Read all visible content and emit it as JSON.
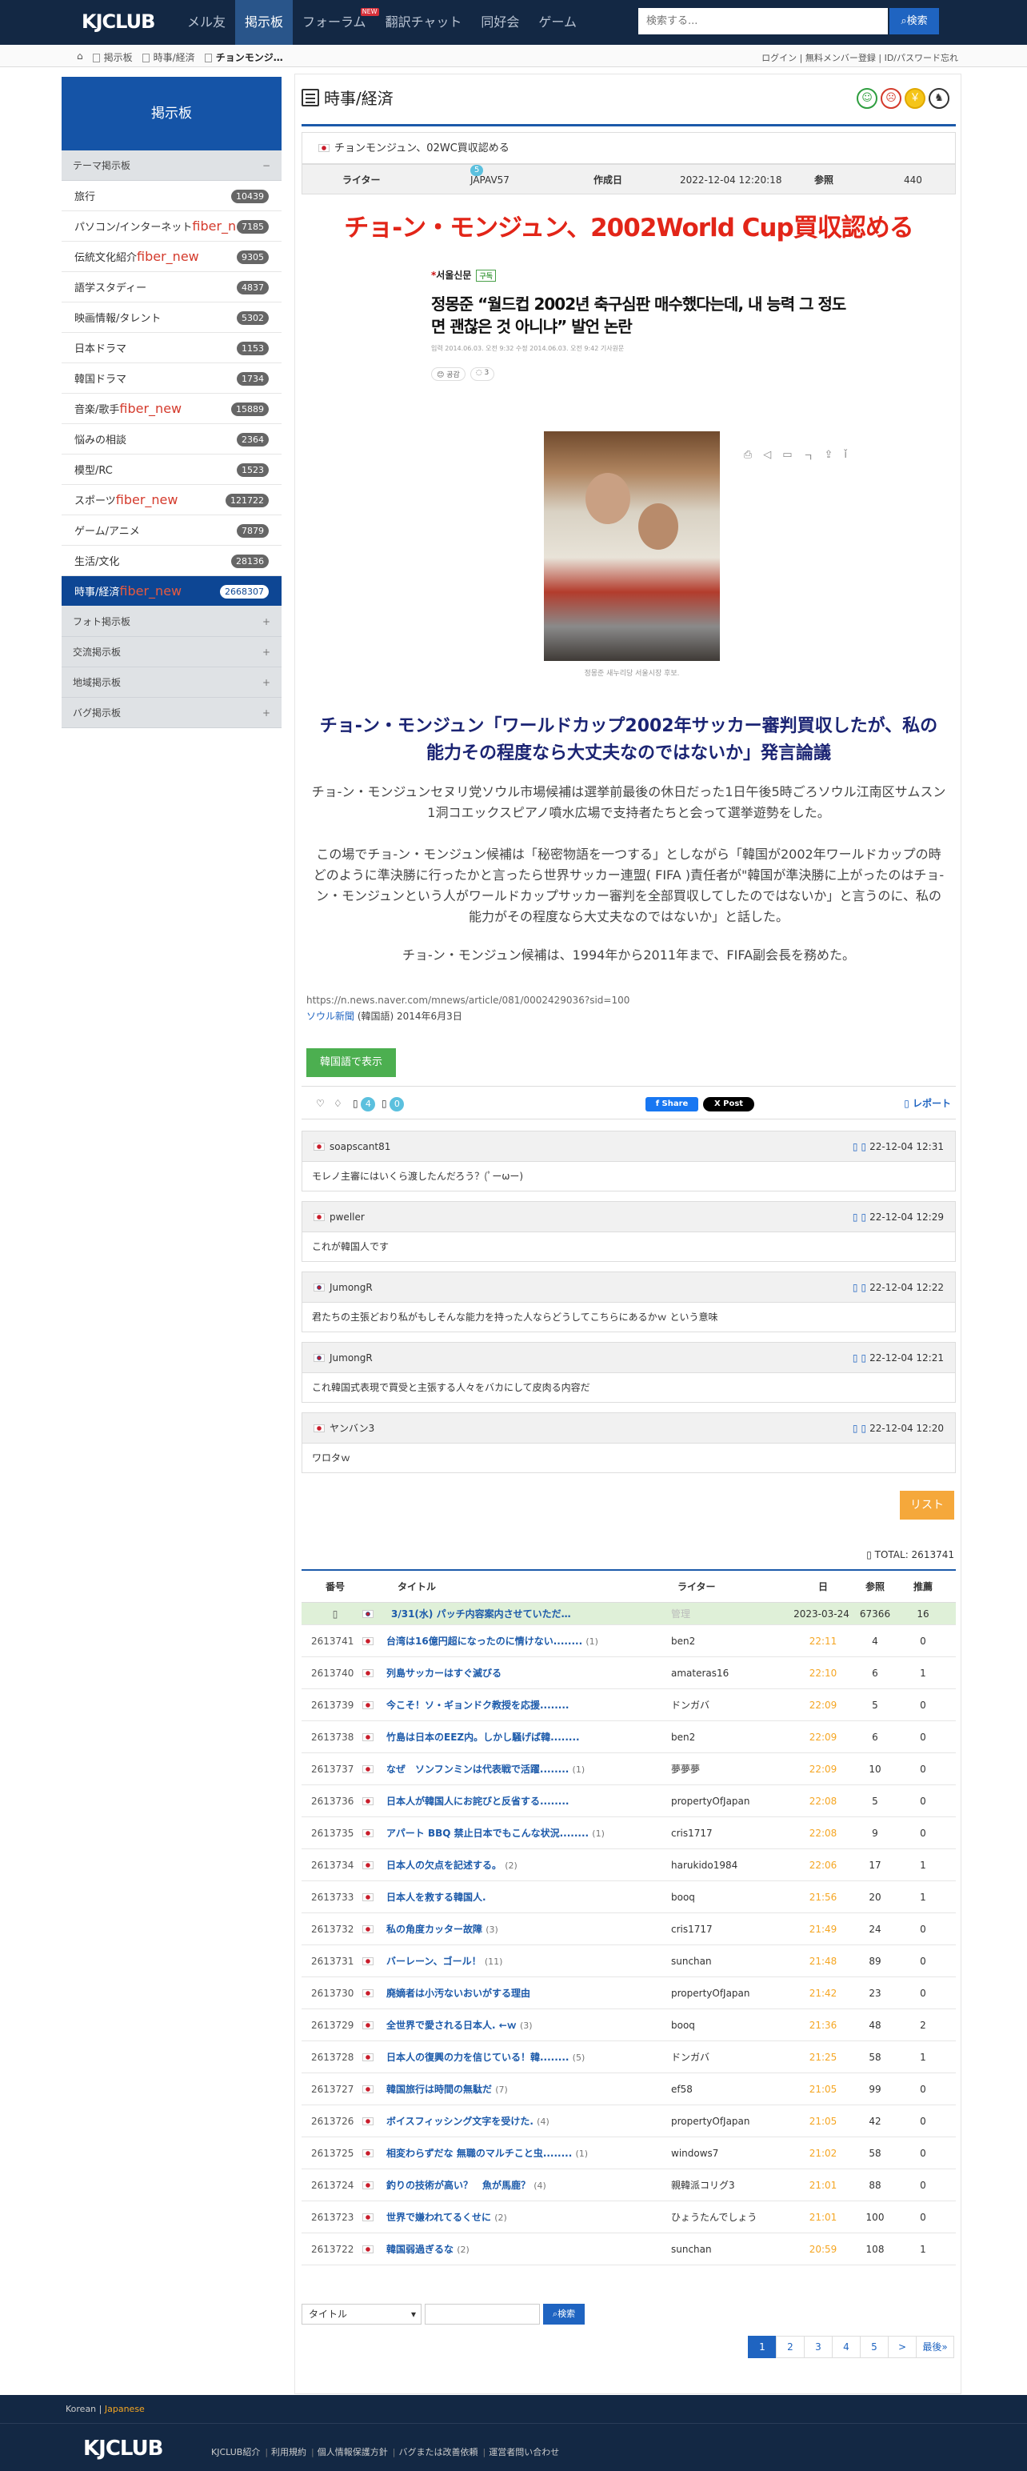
{
  "header": {
    "logo": "KJCLUB",
    "nav": [
      "メル友",
      "掲示板",
      "フォーラム",
      "翻訳チャット",
      "同好会",
      "ゲーム"
    ],
    "nav_new": "NEW",
    "search_placeholder": "検索する...",
    "search_button": "検索"
  },
  "breadcrumb": {
    "items": [
      "掲示板",
      "時事/経済",
      "チョンモンジ…"
    ]
  },
  "userlinks": "ログイン | 無料メンバー登録 | ID/パスワード忘れ",
  "sidebar": {
    "title": "掲示板",
    "section": "テーマ掲示板",
    "items": [
      {
        "label": "旅行",
        "new": "",
        "count": "10439"
      },
      {
        "label": "パソコン/インターネット",
        "new": "fiber_new",
        "count": "7185"
      },
      {
        "label": "伝統文化紹介",
        "new": "fiber_new",
        "count": "9305"
      },
      {
        "label": "語学スタディー",
        "new": "",
        "count": "4837"
      },
      {
        "label": "映画情報/タレント",
        "new": "",
        "count": "5302"
      },
      {
        "label": "日本ドラマ",
        "new": "",
        "count": "1153"
      },
      {
        "label": "韓国ドラマ",
        "new": "",
        "count": "1734"
      },
      {
        "label": "音楽/歌手",
        "new": "fiber_new",
        "count": "15889"
      },
      {
        "label": "悩みの相談",
        "new": "",
        "count": "2364"
      },
      {
        "label": "模型/RC",
        "new": "",
        "count": "1523"
      },
      {
        "label": "スポーツ",
        "new": "fiber_new",
        "count": "121722"
      },
      {
        "label": "ゲーム/アニメ",
        "new": "",
        "count": "7879"
      },
      {
        "label": "生活/文化",
        "new": "",
        "count": "28136"
      },
      {
        "label": "時事/経済",
        "new": "fiber_new",
        "count": "2668307"
      }
    ],
    "sections": [
      "フォト掲示板",
      "交流掲示板",
      "地域掲示板",
      "バグ掲示板"
    ]
  },
  "board": {
    "title": "時事/経済",
    "icons": [
      "☺",
      "☹",
      "￥",
      "♞"
    ]
  },
  "post": {
    "subject": "チョンモンジュン、02WC買収認める",
    "meta": {
      "writer_label": "ライター",
      "level": "5",
      "writer": "JAPAV57",
      "date_label": "作成日",
      "date": "2022-12-04 12:20:18",
      "views_label": "参照",
      "views": "440"
    },
    "headline": "チョ-ン・モンジュン、2002World Cup買収認める",
    "embed": {
      "paper": "서울신문",
      "subscribe": "구독",
      "title1": "정몽준 “월드컵 2002년 축구심판 매수했다는데, 내 능력 그 정도",
      "title2": "면 괜찮은 것 아니냐” 발언 논란",
      "meta": "입력 2014.06.03. 오전 9:32   수정 2014.06.03. 오전 9:42   기사원문",
      "react1": "공감",
      "react2": "3",
      "caption": "정몽준 새누리당 서울시장 후보."
    },
    "article_headline": "チョ-ン・モンジュン「ワールドカップ2002年サッカー審判買収したが、私の能力その程度なら大丈夫なのではないか」発言論議",
    "p1": "チョ-ン・モンジュンセヌリ党ソウル市場候補は選挙前最後の休日だった1日午後5時ごろソウル江南区サムスン1洞コエックスピアノ噴水広場で支持者たちと会って選挙遊勢をした。",
    "p2": "この場でチョ-ン・モンジュン候補は「秘密物語を一つする」としながら「韓国が2002年ワールドカップの時どのように準決勝に行ったかと言ったら世界サッカー連盟( FIFA )責任者が\"韓国が準決勝に上がったのはチョ-ン・モンジュンという人がワールドカップサッカー審判を全部買収してしたのではないか」と言うのに、私の能力がその程度なら大丈夫なのではないか」と話した。",
    "p3": "チョ-ン・モンジュン候補は、1994年から2011年まで、FIFA副会長を務めた。",
    "source_url": "https://n.news.naver.com/mnews/article/081/0002429036?sid=100",
    "source_name": "ソウル新聞",
    "source_rest": " (韓国語) 2014年6月3日",
    "kr_button": "韓国語で表示",
    "likes": "4",
    "dislikes": "0",
    "fb": "f Share",
    "x": "X Post",
    "report": "レポート"
  },
  "comments": [
    {
      "flag": "jp",
      "user": "soapscant81",
      "date": "22-12-04 12:31",
      "text": "モレノ主審にはいくら渡したんだろう？(ﾟーωー)"
    },
    {
      "flag": "jp",
      "user": "pweller",
      "date": "22-12-04 12:29",
      "text": "これが韓国人です"
    },
    {
      "flag": "kr",
      "user": "JumongR",
      "date": "22-12-04 12:22",
      "text": "君たちの主張どおり私がもしそんな能力を持った人ならどうしてこちらにあるかｗ という意味"
    },
    {
      "flag": "kr",
      "user": "JumongR",
      "date": "22-12-04 12:21",
      "text": "これ韓国式表現で買受と主張する人々をバカにして皮肉る内容だ"
    },
    {
      "flag": "jp",
      "user": "ヤンバン3",
      "date": "22-12-04 12:20",
      "text": "ワロタｗ"
    }
  ],
  "list_button": "リスト",
  "total": "TOTAL: 2613741",
  "table": {
    "headers": [
      "番号",
      "タイトル",
      "ライター",
      "日",
      "参照",
      "推薦"
    ],
    "notice": {
      "title": "3/31(水) パッチ内容案内させていただ…",
      "writer": "管理",
      "date": "2023-03-24",
      "views": "67366",
      "rec": "16"
    },
    "rows": [
      {
        "no": "2613741",
        "flag": "jp",
        "title": "台湾は16億円超になったのに情けない........",
        "cm": "(1)",
        "writer": "ben2",
        "time": "22:11",
        "views": "4",
        "rec": "0"
      },
      {
        "no": "2613740",
        "flag": "jp",
        "title": "列島サッカーはすぐ滅びる",
        "cm": "",
        "writer": "amateras16",
        "time": "22:10",
        "views": "6",
        "rec": "1"
      },
      {
        "no": "2613739",
        "flag": "jp",
        "title": "今こそ！ソ・ギョンドク教授を応援........",
        "cm": "",
        "writer": "ドンガバ",
        "time": "22:09",
        "views": "5",
        "rec": "0"
      },
      {
        "no": "2613738",
        "flag": "jp",
        "title": "竹島は日本のEEZ内。しかし騒げば韓........",
        "cm": "",
        "writer": "ben2",
        "time": "22:09",
        "views": "6",
        "rec": "0"
      },
      {
        "no": "2613737",
        "flag": "jp",
        "title": "なぜ　ソンフンミンは代表戦で活躍........",
        "cm": "(1)",
        "writer": "夢夢夢",
        "time": "22:09",
        "views": "10",
        "rec": "0"
      },
      {
        "no": "2613736",
        "flag": "jp",
        "title": "日本人が韓国人にお詫びと反省する........",
        "cm": "",
        "writer": "propertyOfJapan",
        "time": "22:08",
        "views": "5",
        "rec": "0"
      },
      {
        "no": "2613735",
        "flag": "jp",
        "title": "アパート BBQ 禁止日本でもこんな状況........",
        "cm": "(1)",
        "writer": "cris1717",
        "time": "22:08",
        "views": "9",
        "rec": "0"
      },
      {
        "no": "2613734",
        "flag": "jp",
        "title": "日本人の欠点を記述する。",
        "cm": "(2)",
        "writer": "harukido1984",
        "time": "22:06",
        "views": "17",
        "rec": "1"
      },
      {
        "no": "2613733",
        "flag": "jp",
        "title": "日本人を救する韓国人.",
        "cm": "",
        "writer": "booq",
        "time": "21:56",
        "views": "20",
        "rec": "1"
      },
      {
        "no": "2613732",
        "flag": "jp",
        "title": "私の角度カッター故障",
        "cm": "(3)",
        "writer": "cris1717",
        "time": "21:49",
        "views": "24",
        "rec": "0"
      },
      {
        "no": "2613731",
        "flag": "jp",
        "title": "バーレーン、ゴール！",
        "cm": "(11)",
        "writer": "sunchan",
        "time": "21:48",
        "views": "89",
        "rec": "0"
      },
      {
        "no": "2613730",
        "flag": "jp",
        "title": "廃嫡者は小汚ないおいがする理由",
        "cm": "",
        "writer": "propertyOfJapan",
        "time": "21:42",
        "views": "23",
        "rec": "0"
      },
      {
        "no": "2613729",
        "flag": "jp",
        "title": "全世界で愛される日本人. ←ｗ",
        "cm": "(3)",
        "writer": "booq",
        "time": "21:36",
        "views": "48",
        "rec": "2"
      },
      {
        "no": "2613728",
        "flag": "jp",
        "title": "日本人の復興の力を信じている！韓........",
        "cm": "(5)",
        "writer": "ドンガバ",
        "time": "21:25",
        "views": "58",
        "rec": "1"
      },
      {
        "no": "2613727",
        "flag": "jp",
        "title": "韓国旅行は時間の無駄だ",
        "cm": "(7)",
        "writer": "ef58",
        "time": "21:05",
        "views": "99",
        "rec": "0"
      },
      {
        "no": "2613726",
        "flag": "jp",
        "title": "ボイスフィッシング文字を受けた.",
        "cm": "(4)",
        "writer": "propertyOfJapan",
        "time": "21:05",
        "views": "42",
        "rec": "0"
      },
      {
        "no": "2613725",
        "flag": "jp",
        "title": "相変わらずだな 無職のマルチこと虫........",
        "cm": "(1)",
        "writer": "windows7",
        "time": "21:02",
        "views": "58",
        "rec": "0"
      },
      {
        "no": "2613724",
        "flag": "jp",
        "title": "釣りの技術が高い？　魚が馬鹿？",
        "cm": "(4)",
        "writer": "親韓派コリグ3",
        "time": "21:01",
        "views": "88",
        "rec": "0"
      },
      {
        "no": "2613723",
        "flag": "jp",
        "title": "世界で嫌われてるくせに",
        "cm": "(2)",
        "writer": "ひょうたんでしょう",
        "time": "21:01",
        "views": "100",
        "rec": "0"
      },
      {
        "no": "2613722",
        "flag": "jp",
        "title": "韓国弱過ぎるな",
        "cm": "(2)",
        "writer": "sunchan",
        "time": "20:59",
        "views": "108",
        "rec": "1"
      }
    ]
  },
  "bottom_search": {
    "select": "タイトル",
    "button": "検索"
  },
  "pager": [
    "1",
    "2",
    "3",
    "4",
    "5",
    ">",
    "最後»"
  ],
  "footer": {
    "lang_kr": "Korean",
    "lang_sep": "|",
    "lang_jp": "Japanese",
    "logo": "KJCLUB",
    "links": [
      "KJCLUB紹介",
      "利用規約",
      "個人情報保護方針",
      "バグまたは改善依頼",
      "運営者問い合わせ"
    ]
  }
}
